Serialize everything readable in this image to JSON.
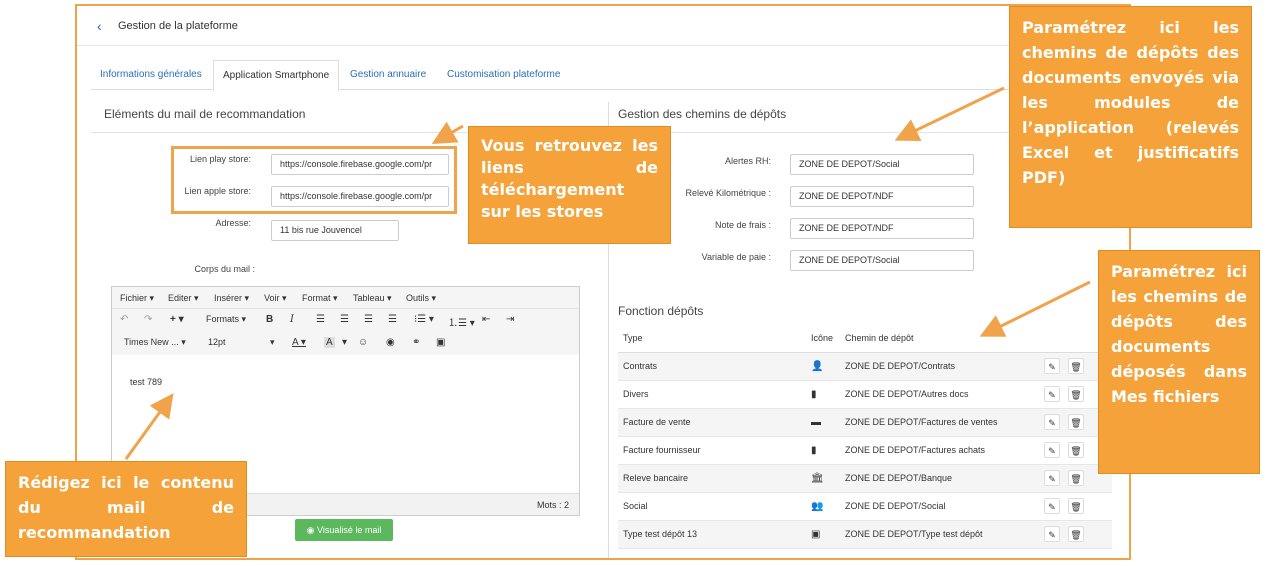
{
  "header": {
    "back_icon": "chevron-left-icon",
    "title": "Gestion de la plateforme"
  },
  "tabs": [
    {
      "label": "Informations générales",
      "active": false
    },
    {
      "label": "Application Smartphone",
      "active": true
    },
    {
      "label": "Gestion annuaire",
      "active": false
    },
    {
      "label": "Customisation plateforme",
      "active": false
    }
  ],
  "left": {
    "title": "Eléments du mail de recommandation",
    "play_store_label": "Lien play store:",
    "play_store_value": "https://console.firebase.google.com/pr",
    "apple_store_label": "Lien apple store:",
    "apple_store_value": "https://console.firebase.google.com/pr",
    "address_label": "Adresse:",
    "address_value": "11 bis rue Jouvencel",
    "body_label": "Corps du mail :"
  },
  "editor": {
    "menu": [
      "Fichier",
      "Editer",
      "Insérer",
      "Voir",
      "Format",
      "Tableau",
      "Outils"
    ],
    "formats_label": "Formats",
    "font_family": "Times New ...",
    "font_size": "12pt",
    "content": "test 789",
    "word_count": "Mots : 2"
  },
  "view_button": "Visualisé le mail",
  "right": {
    "paths_title": "Gestion des chemins de dépôts",
    "paths": [
      {
        "label": "Alertes RH:",
        "value": "ZONE DE DEPOT/Social"
      },
      {
        "label": "Relevé Kilométrique :",
        "value": "ZONE DE DEPOT/NDF"
      },
      {
        "label": "Note de frais :",
        "value": "ZONE DE DEPOT/NDF"
      },
      {
        "label": "Variable de paie :",
        "value": "ZONE DE DEPOT/Social"
      }
    ],
    "functions_title": "Fonction dépôts",
    "columns": {
      "type": "Type",
      "icon": "Icône",
      "path": "Chemin de dépôt"
    },
    "rows": [
      {
        "type": "Contrats",
        "icon": "user-plus-icon",
        "glyph": "👤",
        "path": "ZONE DE DEPOT/Contrats"
      },
      {
        "type": "Divers",
        "icon": "file-icon",
        "glyph": "▮",
        "path": "ZONE DE DEPOT/Autres docs"
      },
      {
        "type": "Facture de vente",
        "icon": "money-bill-icon",
        "glyph": "▬",
        "path": "ZONE DE DEPOT/Factures de ventes"
      },
      {
        "type": "Facture fournisseur",
        "icon": "file-invoice-icon",
        "glyph": "▮",
        "path": "ZONE DE DEPOT/Factures achats"
      },
      {
        "type": "Releve bancaire",
        "icon": "bank-icon",
        "glyph": "🏛",
        "path": "ZONE DE DEPOT/Banque"
      },
      {
        "type": "Social",
        "icon": "users-icon",
        "glyph": "👥",
        "path": "ZONE DE DEPOT/Social"
      },
      {
        "type": "Type test dépôt 13",
        "icon": "id-badge-icon",
        "glyph": "▣",
        "path": "ZONE DE DEPOT/Type test dépôt"
      }
    ]
  },
  "callouts": {
    "stores": "Vous retrouvez les liens de téléchargement sur les stores",
    "mail": "Rédigez ici le contenu du mail de recommandation",
    "paths": "Paramétrez ici les chemins de dépôts des documents envoyés via les modules de l’application (relevés Excel et justificatifs PDF)",
    "functions": "Paramétrez ici les chemins de dépôts des documents déposés dans Mes fichiers"
  },
  "colors": {
    "accent": "#f5a23a",
    "link": "#2b6fb5",
    "success": "#5cb85c"
  }
}
